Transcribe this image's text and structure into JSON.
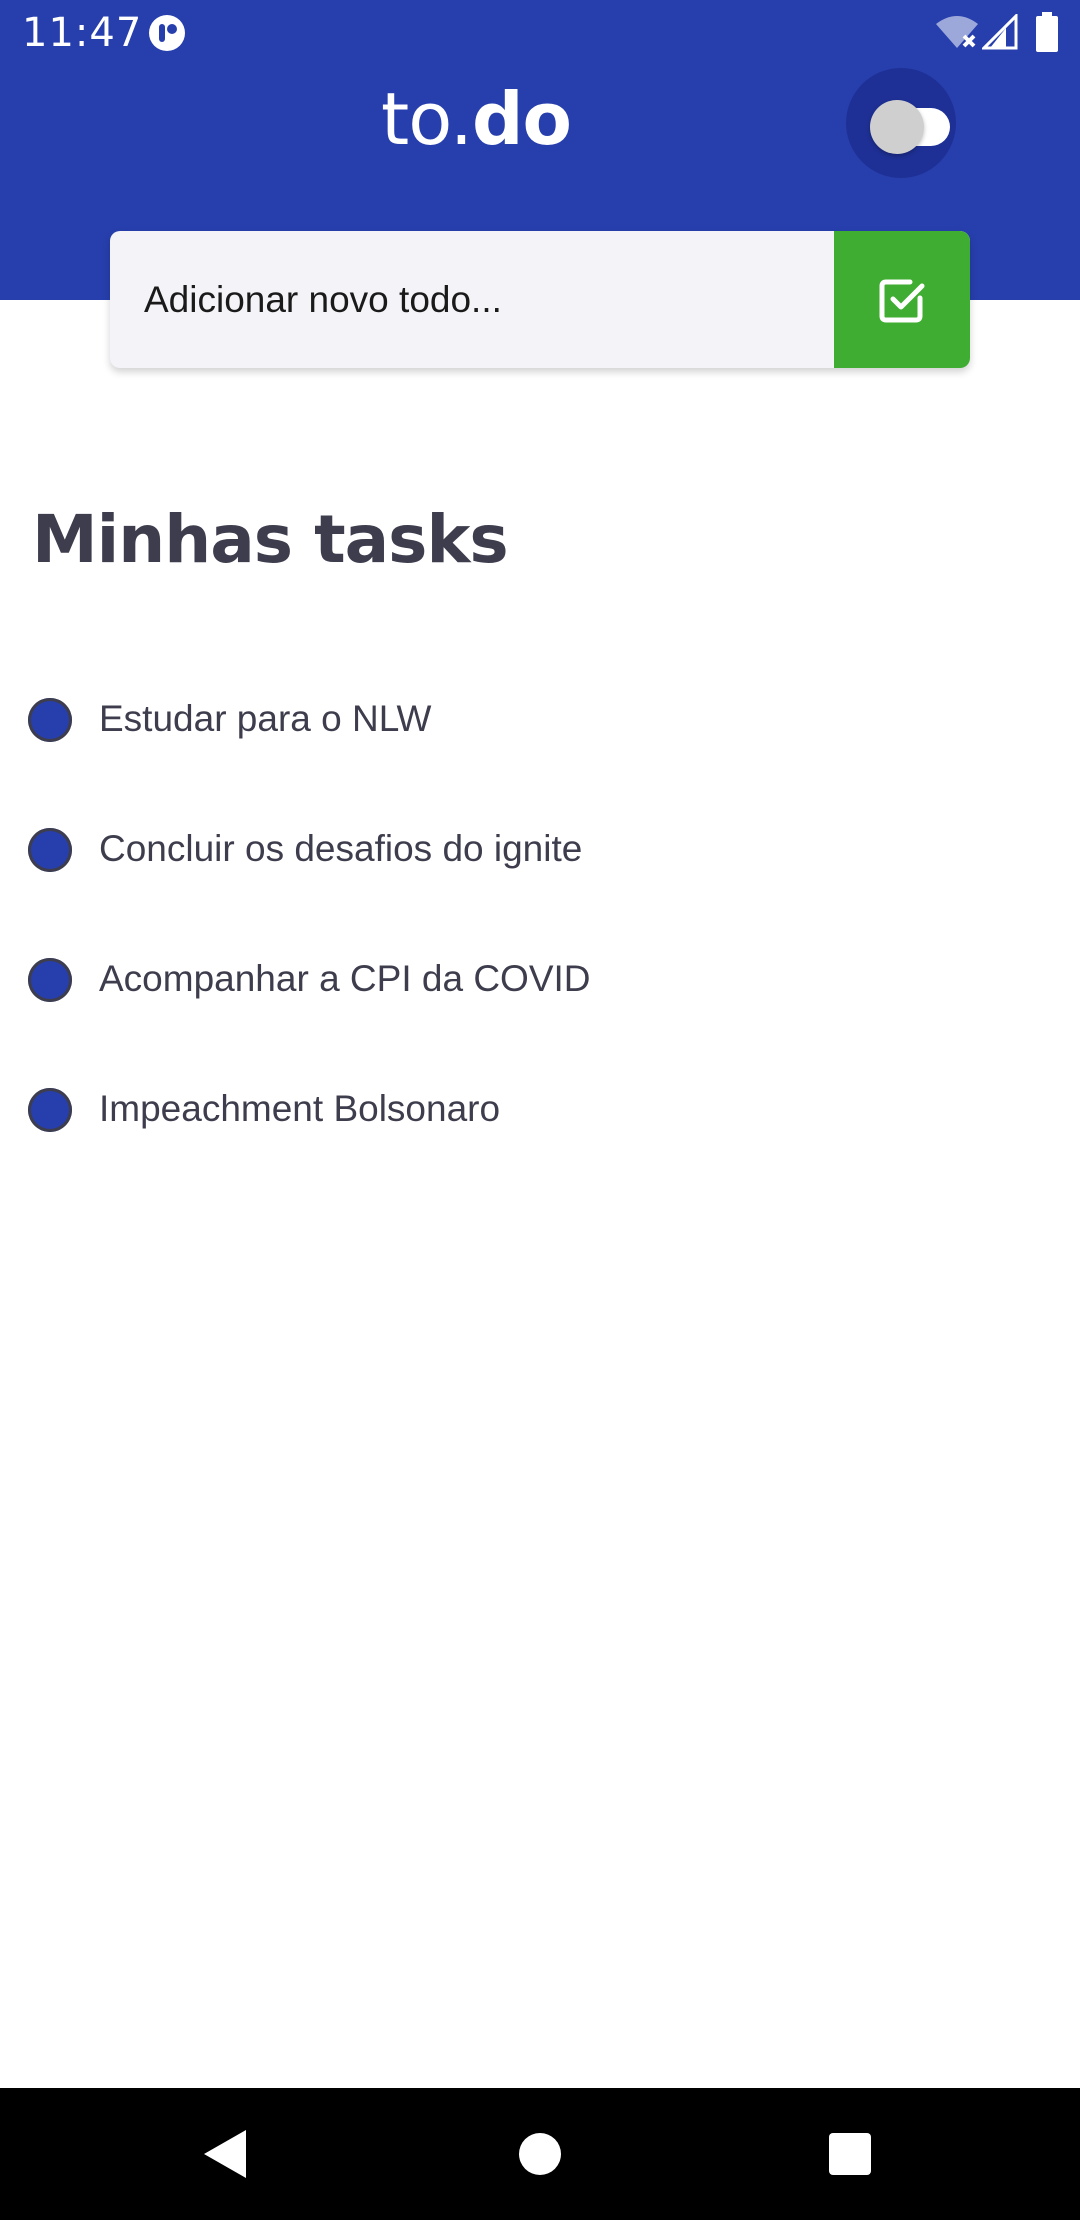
{
  "status_bar": {
    "time": "11:47",
    "icons": [
      "app-notification-icon",
      "wifi-icon",
      "signal-icon",
      "battery-icon"
    ]
  },
  "header": {
    "title_light": "to.",
    "title_bold": "do",
    "theme_toggle": {
      "state": "off"
    }
  },
  "new_todo": {
    "placeholder": "Adicionar novo todo...",
    "value": "",
    "submit_icon": "check-square-icon"
  },
  "tasks_section": {
    "title": "Minhas tasks",
    "items": [
      {
        "label": "Estudar para o NLW",
        "done": false
      },
      {
        "label": "Concluir os desafios do ignite",
        "done": false
      },
      {
        "label": "Acompanhar a CPI da COVID",
        "done": false
      },
      {
        "label": "Impeachment Bolsonaro",
        "done": false
      }
    ]
  },
  "nav_bar": {
    "buttons": [
      "back-icon",
      "home-icon",
      "recents-icon"
    ]
  },
  "colors": {
    "primary": "#273FAD",
    "accent_green": "#3FAD31",
    "text_dark": "#3D3D4D",
    "input_bg": "#F3F3F8",
    "toggle_thumb": "#CFCFCF"
  }
}
